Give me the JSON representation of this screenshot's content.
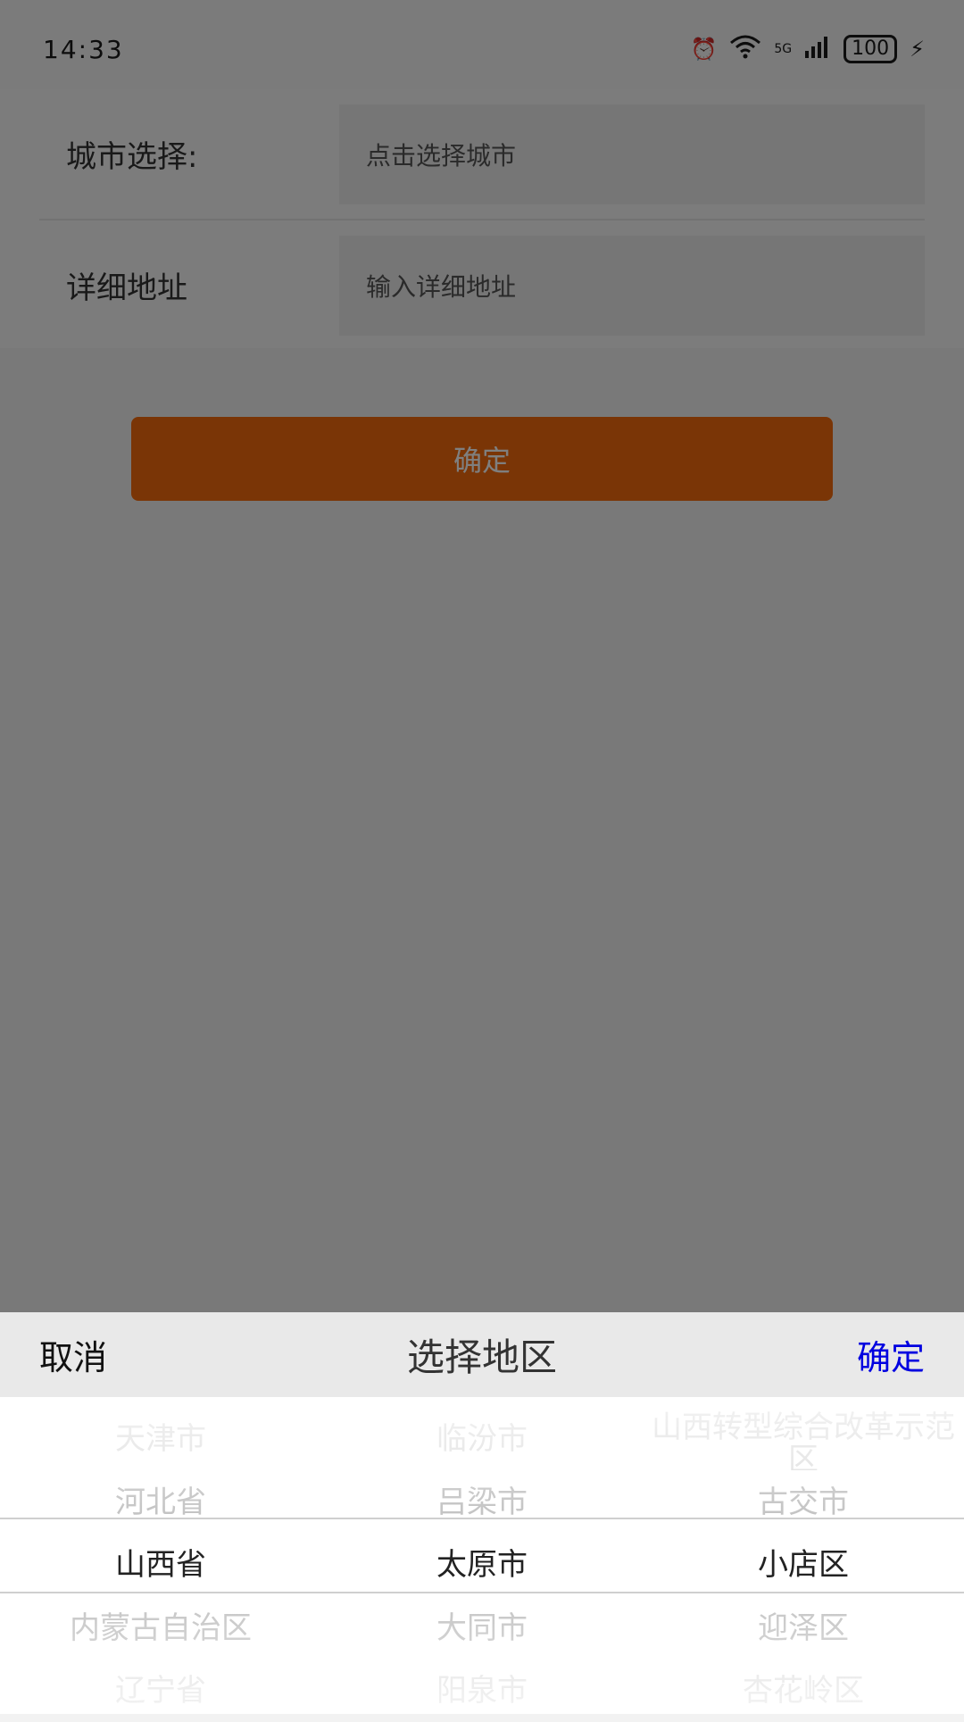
{
  "status_bar": {
    "time": "14:33",
    "network": "5G",
    "battery": "100",
    "icons": [
      "alarm-icon",
      "wifi-icon",
      "signal-icon",
      "battery-icon",
      "charging-icon"
    ]
  },
  "form": {
    "city_label": "城市选择:",
    "city_placeholder": "点击选择城市",
    "address_label": "详细地址",
    "address_placeholder": "输入详细地址",
    "submit_label": "确定"
  },
  "picker": {
    "cancel_label": "取消",
    "title": "选择地区",
    "confirm_label": "确定",
    "provinces": [
      "天津市",
      "河北省",
      "山西省",
      "内蒙古自治区",
      "辽宁省"
    ],
    "cities": [
      "临汾市",
      "吕梁市",
      "太原市",
      "大同市",
      "阳泉市"
    ],
    "districts": [
      "山西转型综合改革示范区",
      "古交市",
      "小店区",
      "迎泽区",
      "杏花岭区"
    ],
    "selected": {
      "province": "山西省",
      "city": "太原市",
      "district": "小店区"
    }
  },
  "colors": {
    "accent": "#f46a0c",
    "confirm_text": "#0000e0"
  }
}
